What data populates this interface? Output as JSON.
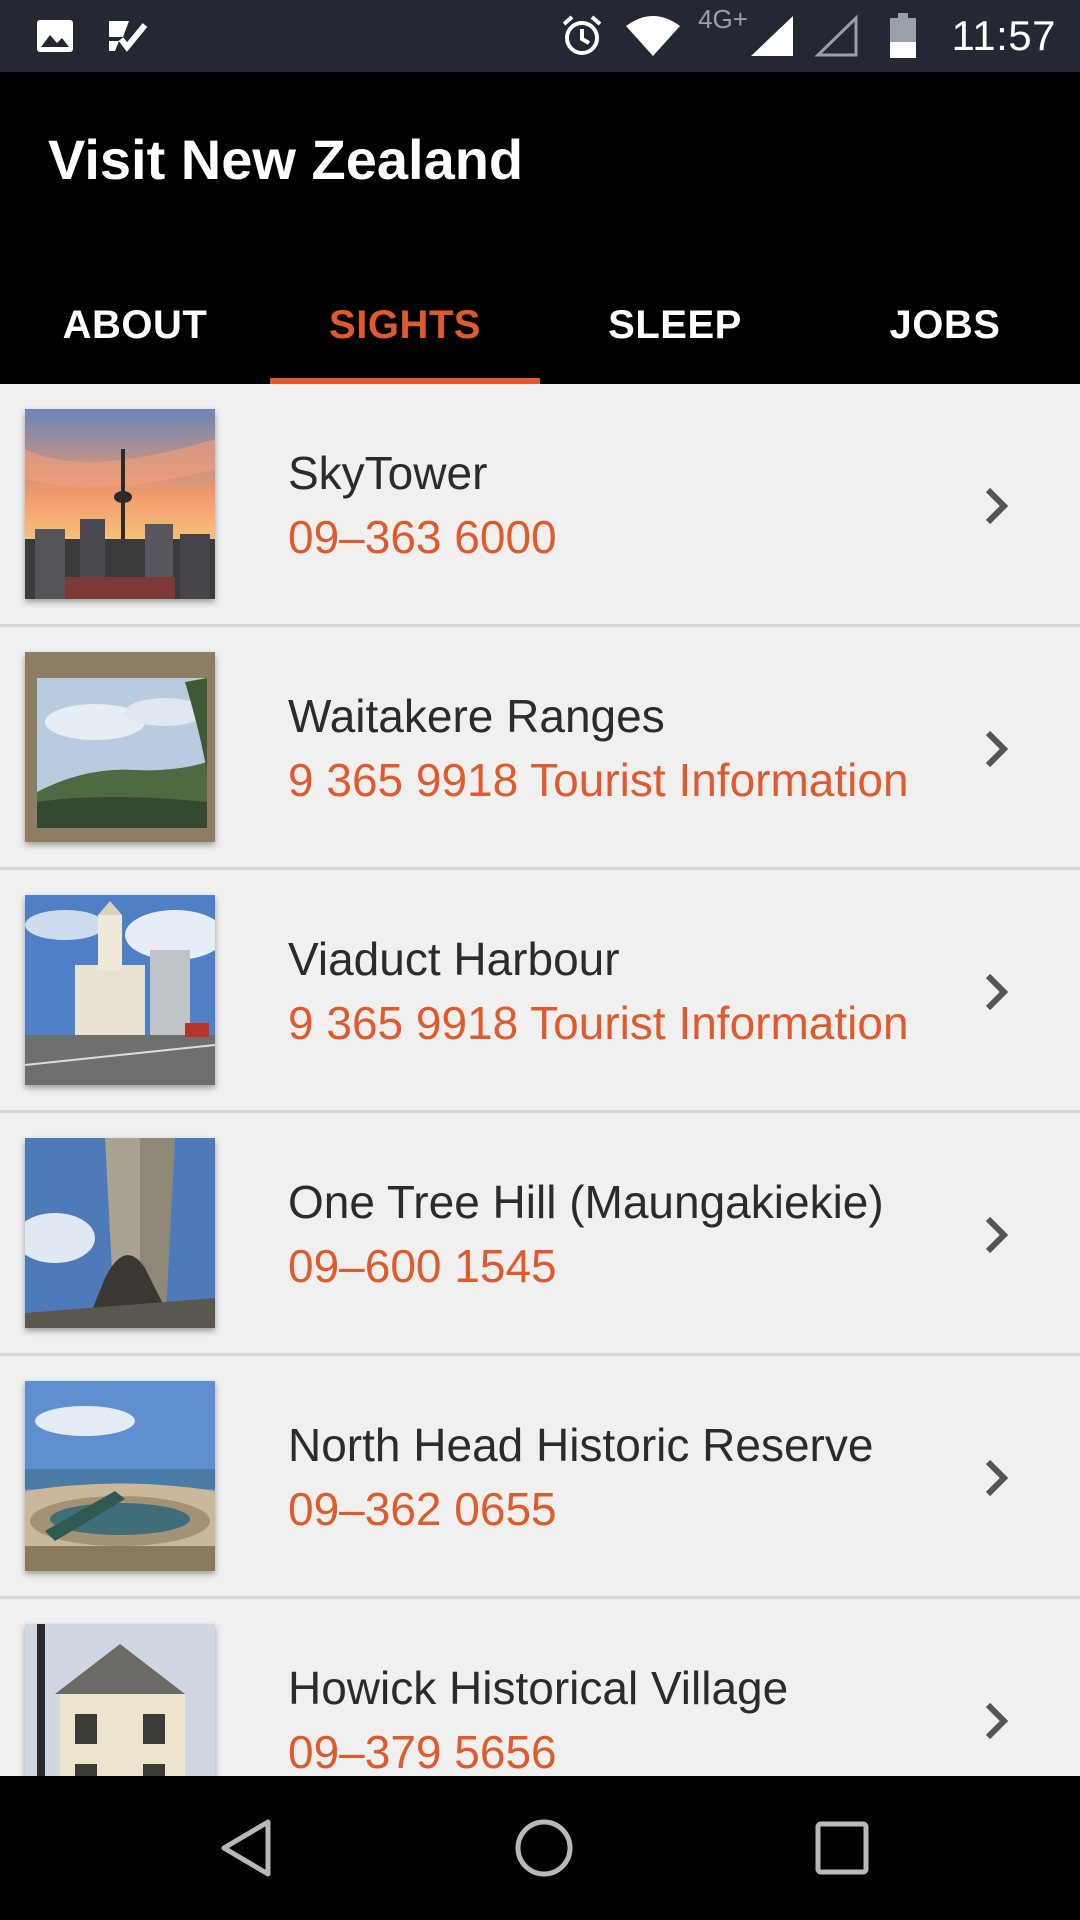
{
  "status_bar": {
    "time": "11:57",
    "network": "4G+",
    "icons": [
      "image-icon",
      "checklist-icon",
      "alarm-icon",
      "wifi-icon",
      "signal-icon",
      "signal-empty-icon",
      "battery-icon"
    ]
  },
  "app": {
    "title": "Visit New Zealand"
  },
  "tabs": [
    {
      "label": "ABOUT",
      "active": false
    },
    {
      "label": "SIGHTS",
      "active": true
    },
    {
      "label": "SLEEP",
      "active": false
    },
    {
      "label": "JOBS",
      "active": false
    }
  ],
  "sights": [
    {
      "title": "SkyTower",
      "phone": "09–363 6000",
      "image": "skytower-photo"
    },
    {
      "title": "Waitakere Ranges",
      "phone": "9 365 9918 Tourist Information",
      "image": "waitakere-photo"
    },
    {
      "title": "Viaduct Harbour",
      "phone": "9 365 9918 Tourist Information",
      "image": "viaduct-photo"
    },
    {
      "title": "One Tree Hill (Maungakiekie)",
      "phone": "09–600 1545",
      "image": "one-tree-hill-photo"
    },
    {
      "title": "North Head Historic Reserve",
      "phone": "09–362 0655",
      "image": "north-head-photo"
    },
    {
      "title": "Howick Historical Village",
      "phone": "09–379 5656",
      "image": "howick-photo"
    }
  ],
  "nav_bar": {
    "buttons": [
      "back-icon",
      "home-icon",
      "recents-icon"
    ]
  },
  "colors": {
    "accent": "#e05a2b",
    "app_bar": "#000000",
    "status_bar": "#232833",
    "list_bg": "#f0f0f0"
  }
}
